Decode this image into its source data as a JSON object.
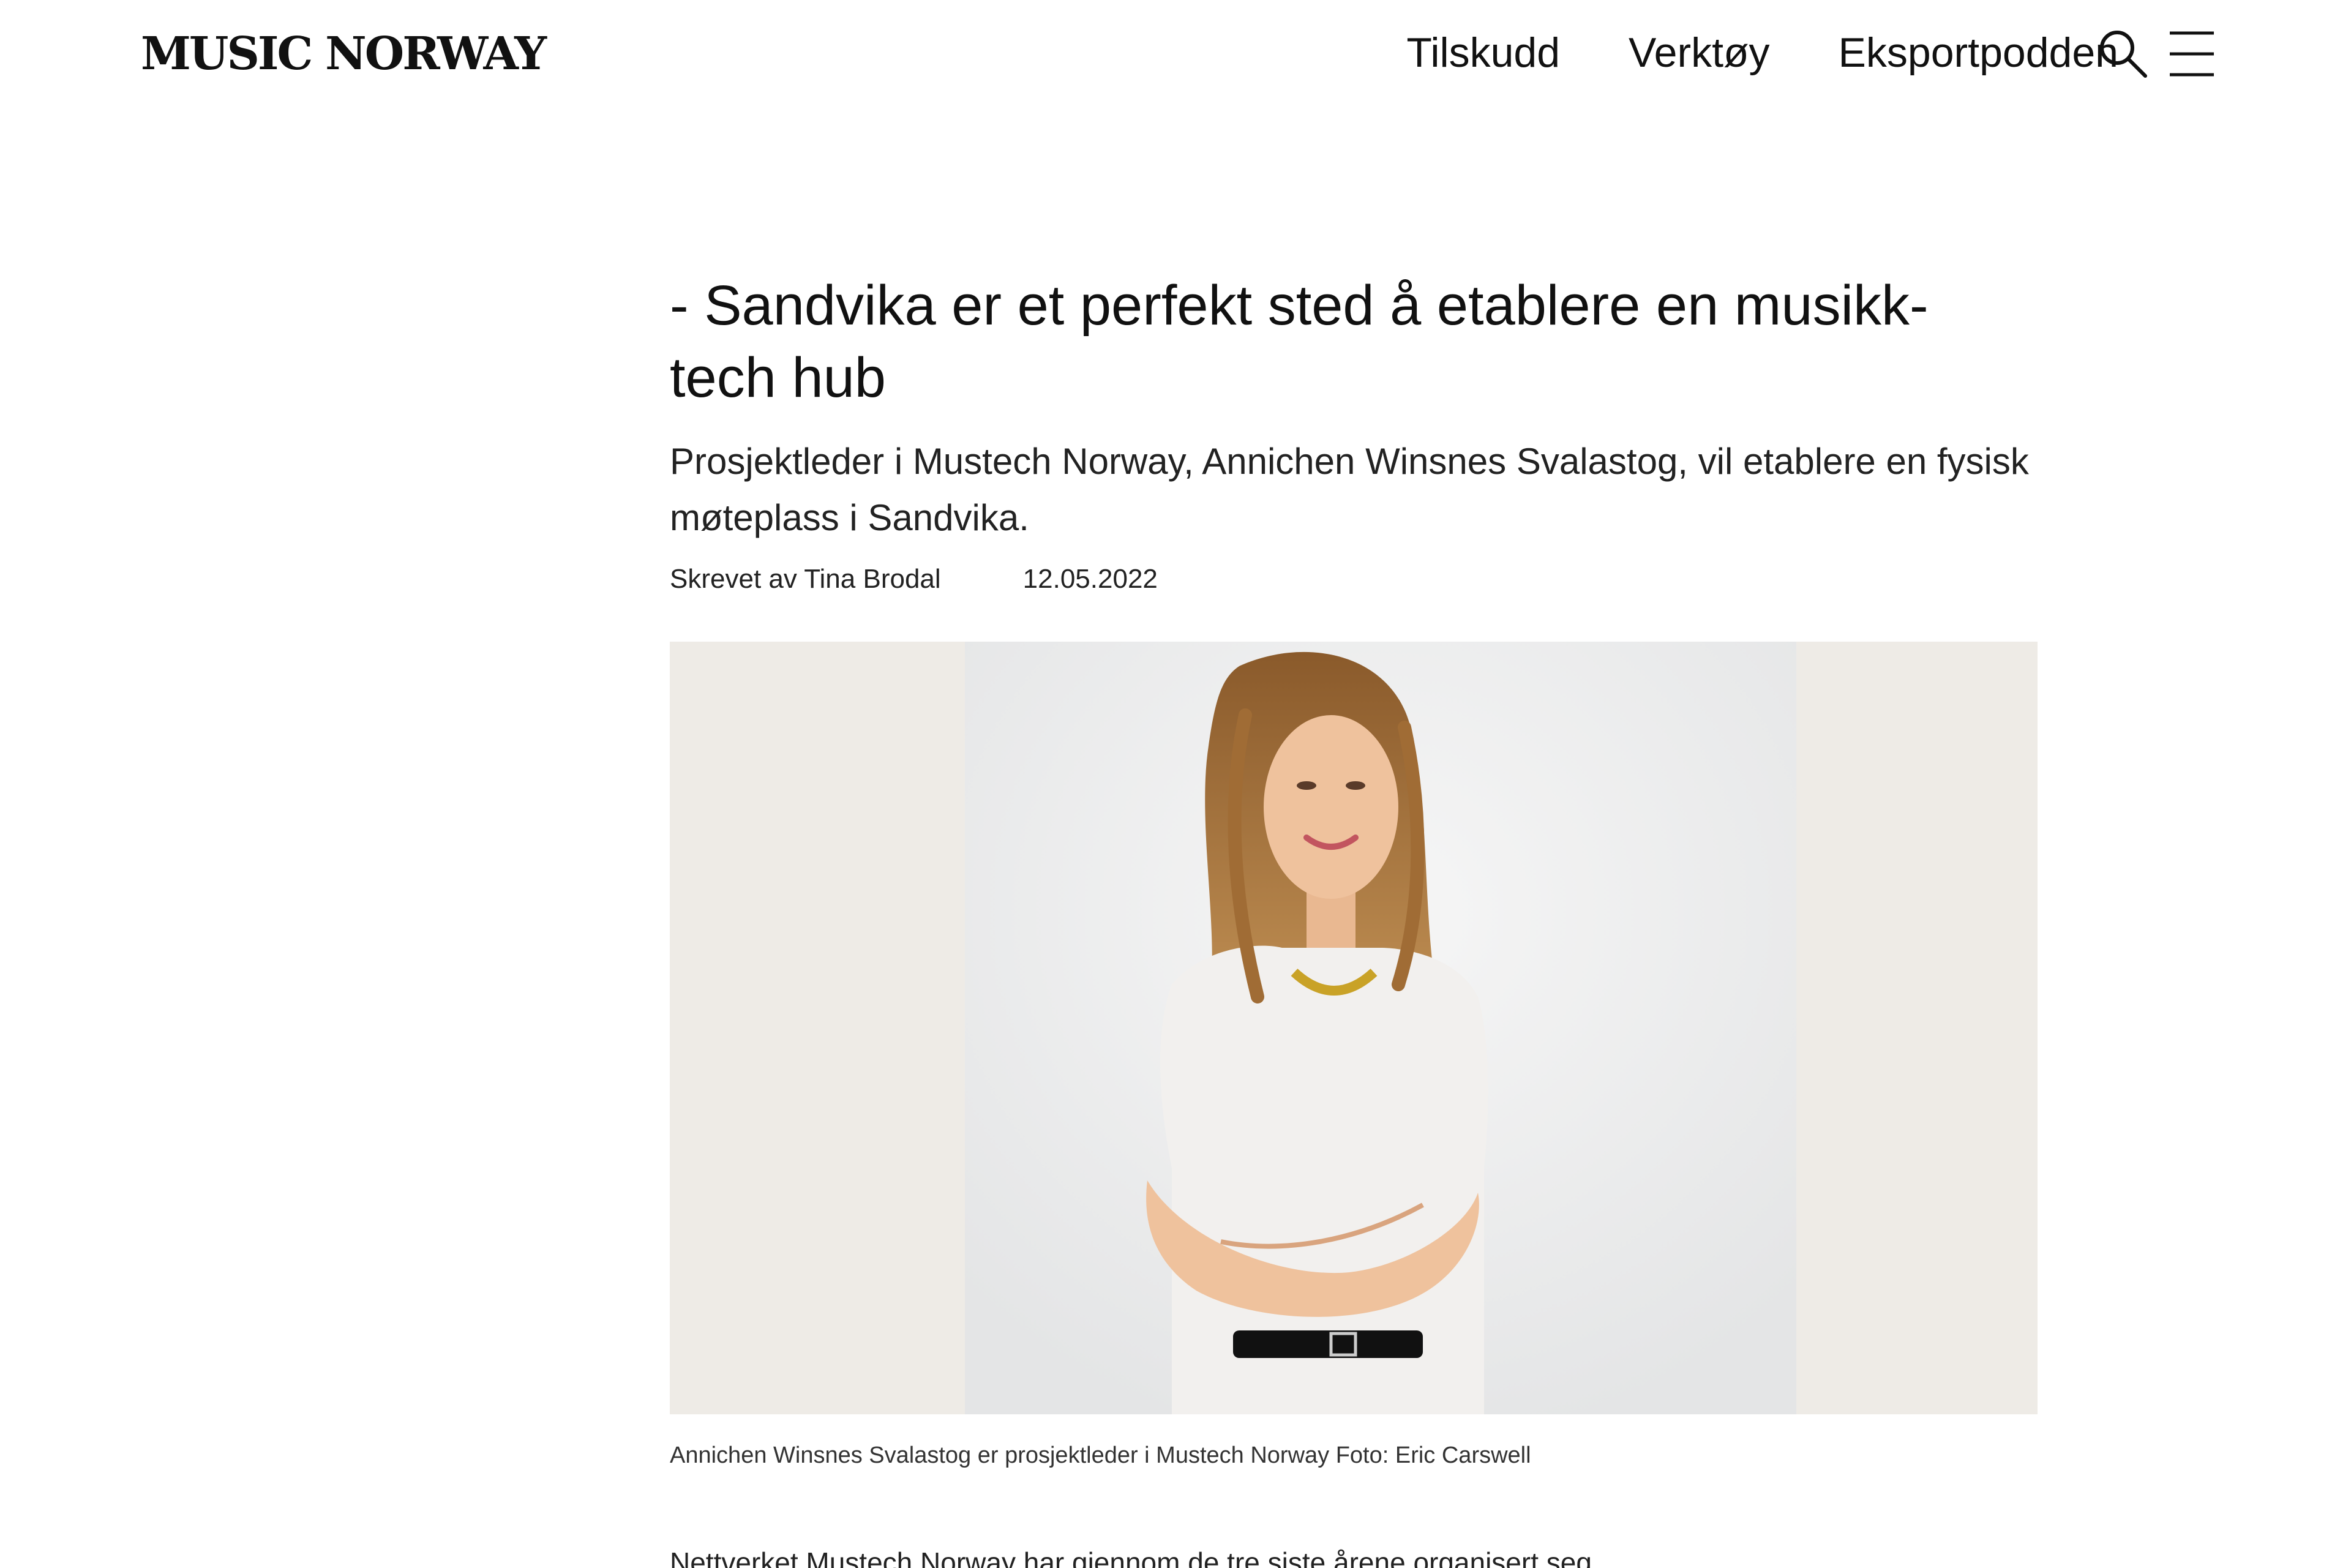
{
  "header": {
    "logo": "MUSIC NORWAY",
    "nav": [
      {
        "label": "Tilskudd"
      },
      {
        "label": "Verktøy"
      },
      {
        "label": "Eksportpodden"
      }
    ],
    "icons": {
      "search": "search-icon",
      "menu": "hamburger-menu-icon"
    }
  },
  "article": {
    "title": "- Sandvika er et perfekt sted å etablere en musikk-tech hub",
    "lede": "Prosjektleder i Mustech Norway, Annichen Winsnes Svalastog, vil etablere en fysisk møteplass i Sandvika.",
    "author": "Skrevet av Tina Brodal",
    "date": "12.05.2022",
    "image_caption": "Annichen Winsnes Svalastog er prosjektleder i Mustech Norway Foto: Eric Carswell",
    "body_start": "Nettverket Mustech Norway har gjennom de tre siste årene organisert seg"
  },
  "colors": {
    "text": "#111111",
    "background": "#ffffff",
    "photo_backdrop": "#efece7"
  }
}
